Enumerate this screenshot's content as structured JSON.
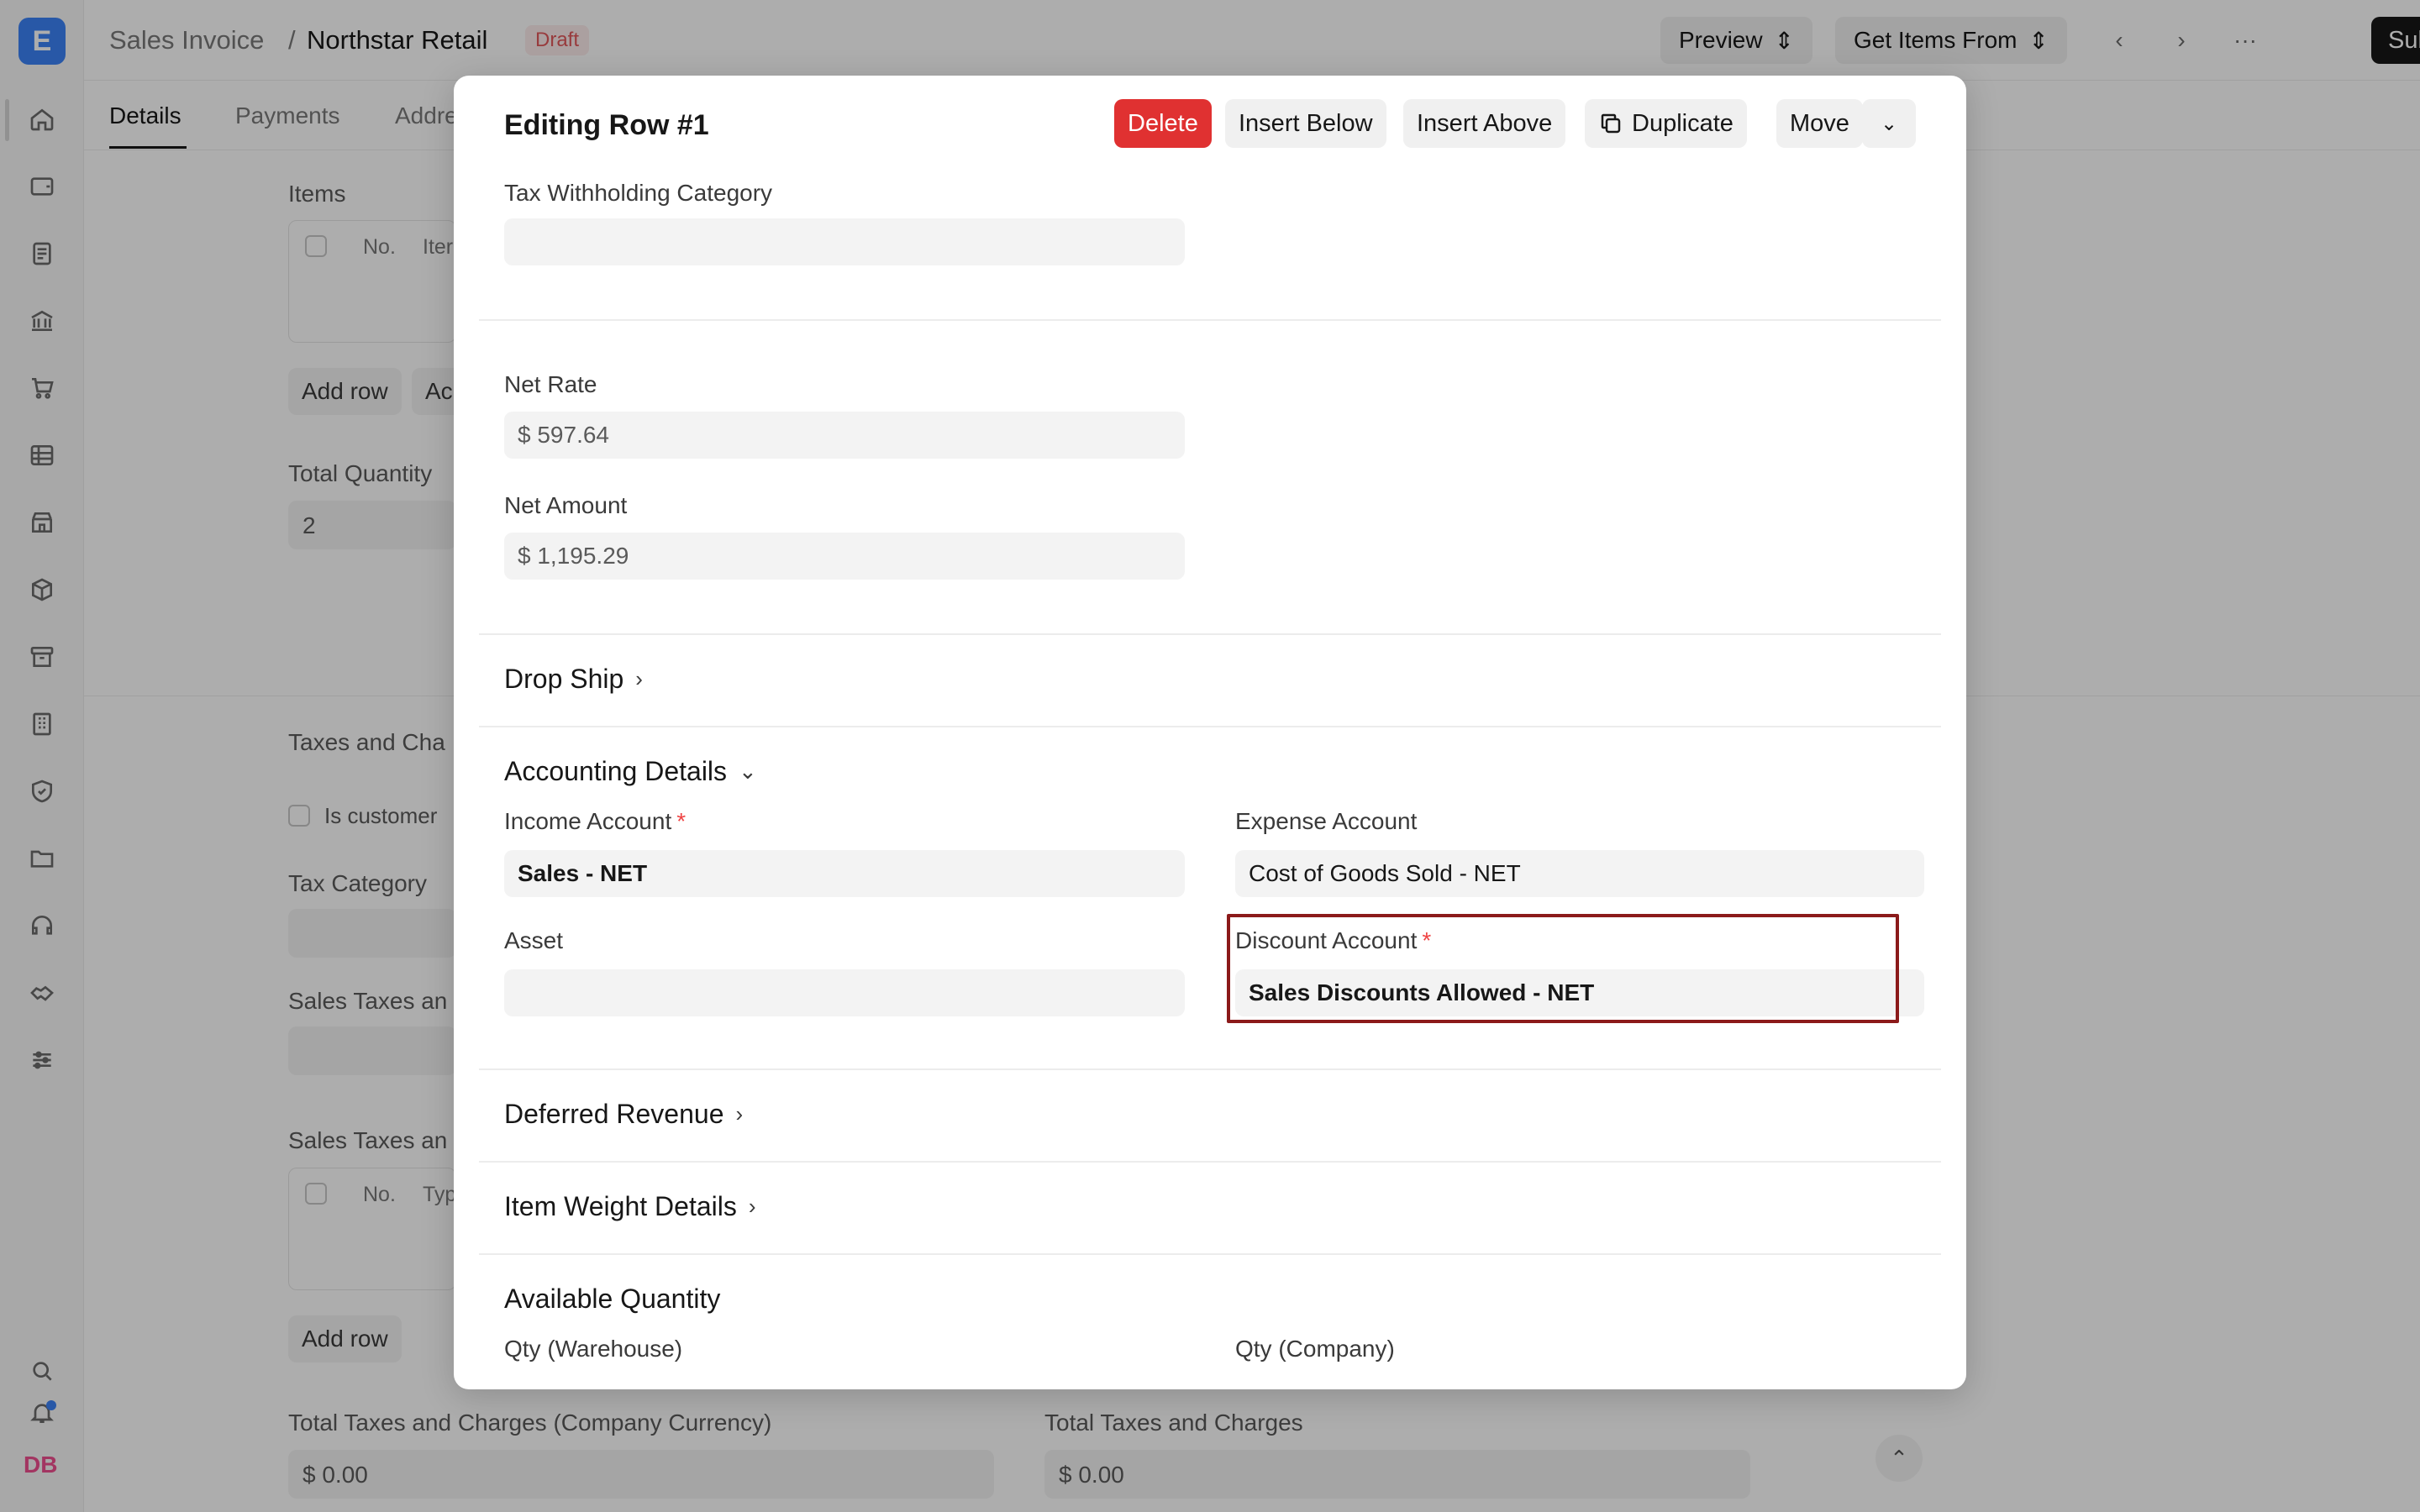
{
  "app": {
    "logo_letter": "E",
    "avatar_initials": "DB"
  },
  "breadcrumb": {
    "parent": "Sales Invoice",
    "separator": "/",
    "current": "Northstar Retail",
    "status": "Draft"
  },
  "toolbar": {
    "preview": "Preview",
    "get_items_from": "Get Items From",
    "more": "···",
    "submit": "Submit"
  },
  "tabs": [
    "Details",
    "Payments",
    "Addre"
  ],
  "background": {
    "items_label": "Items",
    "col_no": "No.",
    "col_item": "Iter",
    "add_row": "Add row",
    "add_more": "Ac",
    "total_quantity_label": "Total Quantity",
    "total_quantity_value": "2",
    "taxes_label": "Taxes and Cha",
    "is_customer_label": "Is customer",
    "tax_category_label": "Tax Category",
    "sales_taxes_label_1": "Sales Taxes an",
    "sales_taxes_label_2": "Sales Taxes an",
    "col_type": "Typ",
    "add_row_2": "Add row",
    "total_taxes_company_label": "Total Taxes and Charges (Company Currency)",
    "total_taxes_company_value": "$ 0.00",
    "total_taxes_label": "Total Taxes and Charges",
    "total_taxes_value": "$ 0.00"
  },
  "modal": {
    "title": "Editing Row #1",
    "buttons": {
      "delete": "Delete",
      "insert_below": "Insert Below",
      "insert_above": "Insert Above",
      "duplicate": "Duplicate",
      "move": "Move"
    },
    "tax_withholding_label": "Tax Withholding Category",
    "tax_withholding_value": "",
    "net_rate_label": "Net Rate",
    "net_rate_value": "$ 597.64",
    "net_amount_label": "Net Amount",
    "net_amount_value": "$ 1,195.29",
    "sections": {
      "drop_ship": "Drop Ship",
      "accounting_details": "Accounting Details",
      "deferred_revenue": "Deferred Revenue",
      "item_weight_details": "Item Weight Details",
      "available_quantity": "Available Quantity"
    },
    "income_account_label": "Income Account",
    "income_account_value": "Sales - NET",
    "expense_account_label": "Expense Account",
    "expense_account_value": "Cost of Goods Sold - NET",
    "asset_label": "Asset",
    "asset_value": "",
    "discount_account_label": "Discount Account",
    "discount_account_value": "Sales Discounts Allowed - NET",
    "required_mark": "*",
    "qty_warehouse_label": "Qty (Warehouse)",
    "qty_company_label": "Qty (Company)"
  },
  "colors": {
    "danger": "#e03131",
    "highlight": "#8b1a1a",
    "accent": "#3b82f6"
  }
}
